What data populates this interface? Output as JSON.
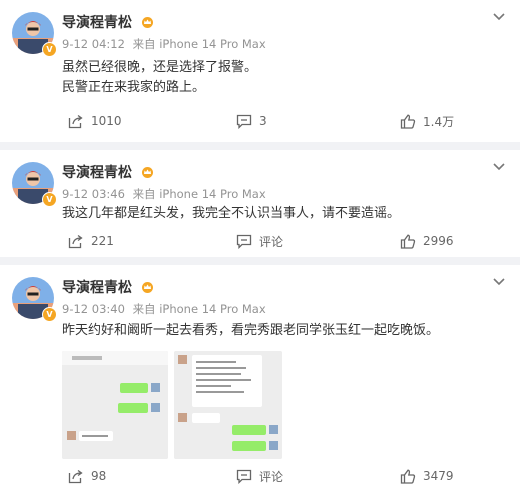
{
  "posts": [
    {
      "user": "导演程青松",
      "time": "9-12 04:12",
      "source": "来自 iPhone 14 Pro Max",
      "lines": [
        "虽然已经很晚，还是选择了报警。",
        "民警正在来我家的路上。"
      ],
      "shares": "1010",
      "comments": "3",
      "likes": "1.4万"
    },
    {
      "user": "导演程青松",
      "time": "9-12 03:46",
      "source": "来自 iPhone 14 Pro Max",
      "lines": [
        "我这几年都是红头发，我完全不认识当事人，请不要造谣。"
      ],
      "shares": "221",
      "comments": "评论",
      "likes": "2996"
    },
    {
      "user": "导演程青松",
      "time": "9-12 03:40",
      "source": "来自 iPhone 14 Pro Max",
      "lines": [
        "昨天约好和阚昕一起去看秀，看完秀跟老同学张玉红一起吃晚饭。"
      ],
      "shares": "98",
      "comments": "评论",
      "likes": "3479"
    }
  ],
  "colors": {
    "accent_orange": "#f5a623",
    "chat_green": "#95ec69",
    "meta_gray": "#939393"
  },
  "icons": [
    "avatar-photo",
    "crown-icon",
    "verified-badge-icon",
    "more-menu-icon",
    "share-icon",
    "comment-icon",
    "like-icon"
  ]
}
